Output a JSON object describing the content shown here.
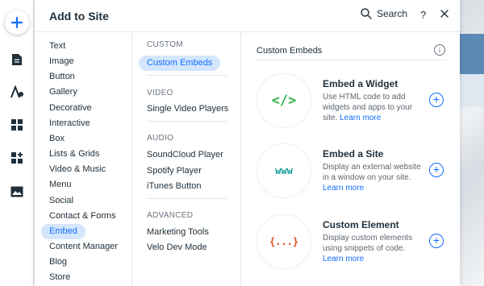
{
  "rail": {
    "icons": [
      "add-icon",
      "pages-icon",
      "design-icon",
      "apps-icon",
      "app-market-icon",
      "media-icon"
    ],
    "accent": "#116dff"
  },
  "panel": {
    "title": "Add to Site",
    "search_label": "Search",
    "help_label": "?"
  },
  "categories": [
    {
      "label": "Text",
      "active": false
    },
    {
      "label": "Image",
      "active": false
    },
    {
      "label": "Button",
      "active": false
    },
    {
      "label": "Gallery",
      "active": false
    },
    {
      "label": "Decorative",
      "active": false
    },
    {
      "label": "Interactive",
      "active": false
    },
    {
      "label": "Box",
      "active": false
    },
    {
      "label": "Lists & Grids",
      "active": false
    },
    {
      "label": "Video & Music",
      "active": false
    },
    {
      "label": "Menu",
      "active": false
    },
    {
      "label": "Social",
      "active": false
    },
    {
      "label": "Contact & Forms",
      "active": false
    },
    {
      "label": "Embed",
      "active": true
    },
    {
      "label": "Content Manager",
      "active": false
    },
    {
      "label": "Blog",
      "active": false
    },
    {
      "label": "Store",
      "active": false
    }
  ],
  "sections": [
    {
      "heading": "CUSTOM",
      "items": [
        "Custom Embeds"
      ]
    },
    {
      "heading": "VIDEO",
      "items": [
        "Single Video Players"
      ]
    },
    {
      "heading": "AUDIO",
      "items": [
        "SoundCloud Player",
        "Spotify Player",
        "iTunes Button"
      ]
    },
    {
      "heading": "ADVANCED",
      "items": [
        "Marketing Tools",
        "Velo Dev Mode"
      ]
    }
  ],
  "content": {
    "title": "Custom Embeds",
    "info_label": "i",
    "items": [
      {
        "title": "Embed a Widget",
        "desc": "Use HTML code to add widgets and apps to your site.",
        "link": "Learn more",
        "thumb": "</>",
        "thumb_color": "#2eb34a"
      },
      {
        "title": "Embed a Site",
        "desc": "Display an external website in a window on your site.",
        "link": "Learn more",
        "thumb": "www",
        "thumb_color": "#1a9b9b"
      },
      {
        "title": "Custom Element",
        "desc": "Display custom elements using snippets of code.",
        "link": "Learn more",
        "thumb": "{...}",
        "thumb_color": "#e8461e"
      }
    ]
  }
}
